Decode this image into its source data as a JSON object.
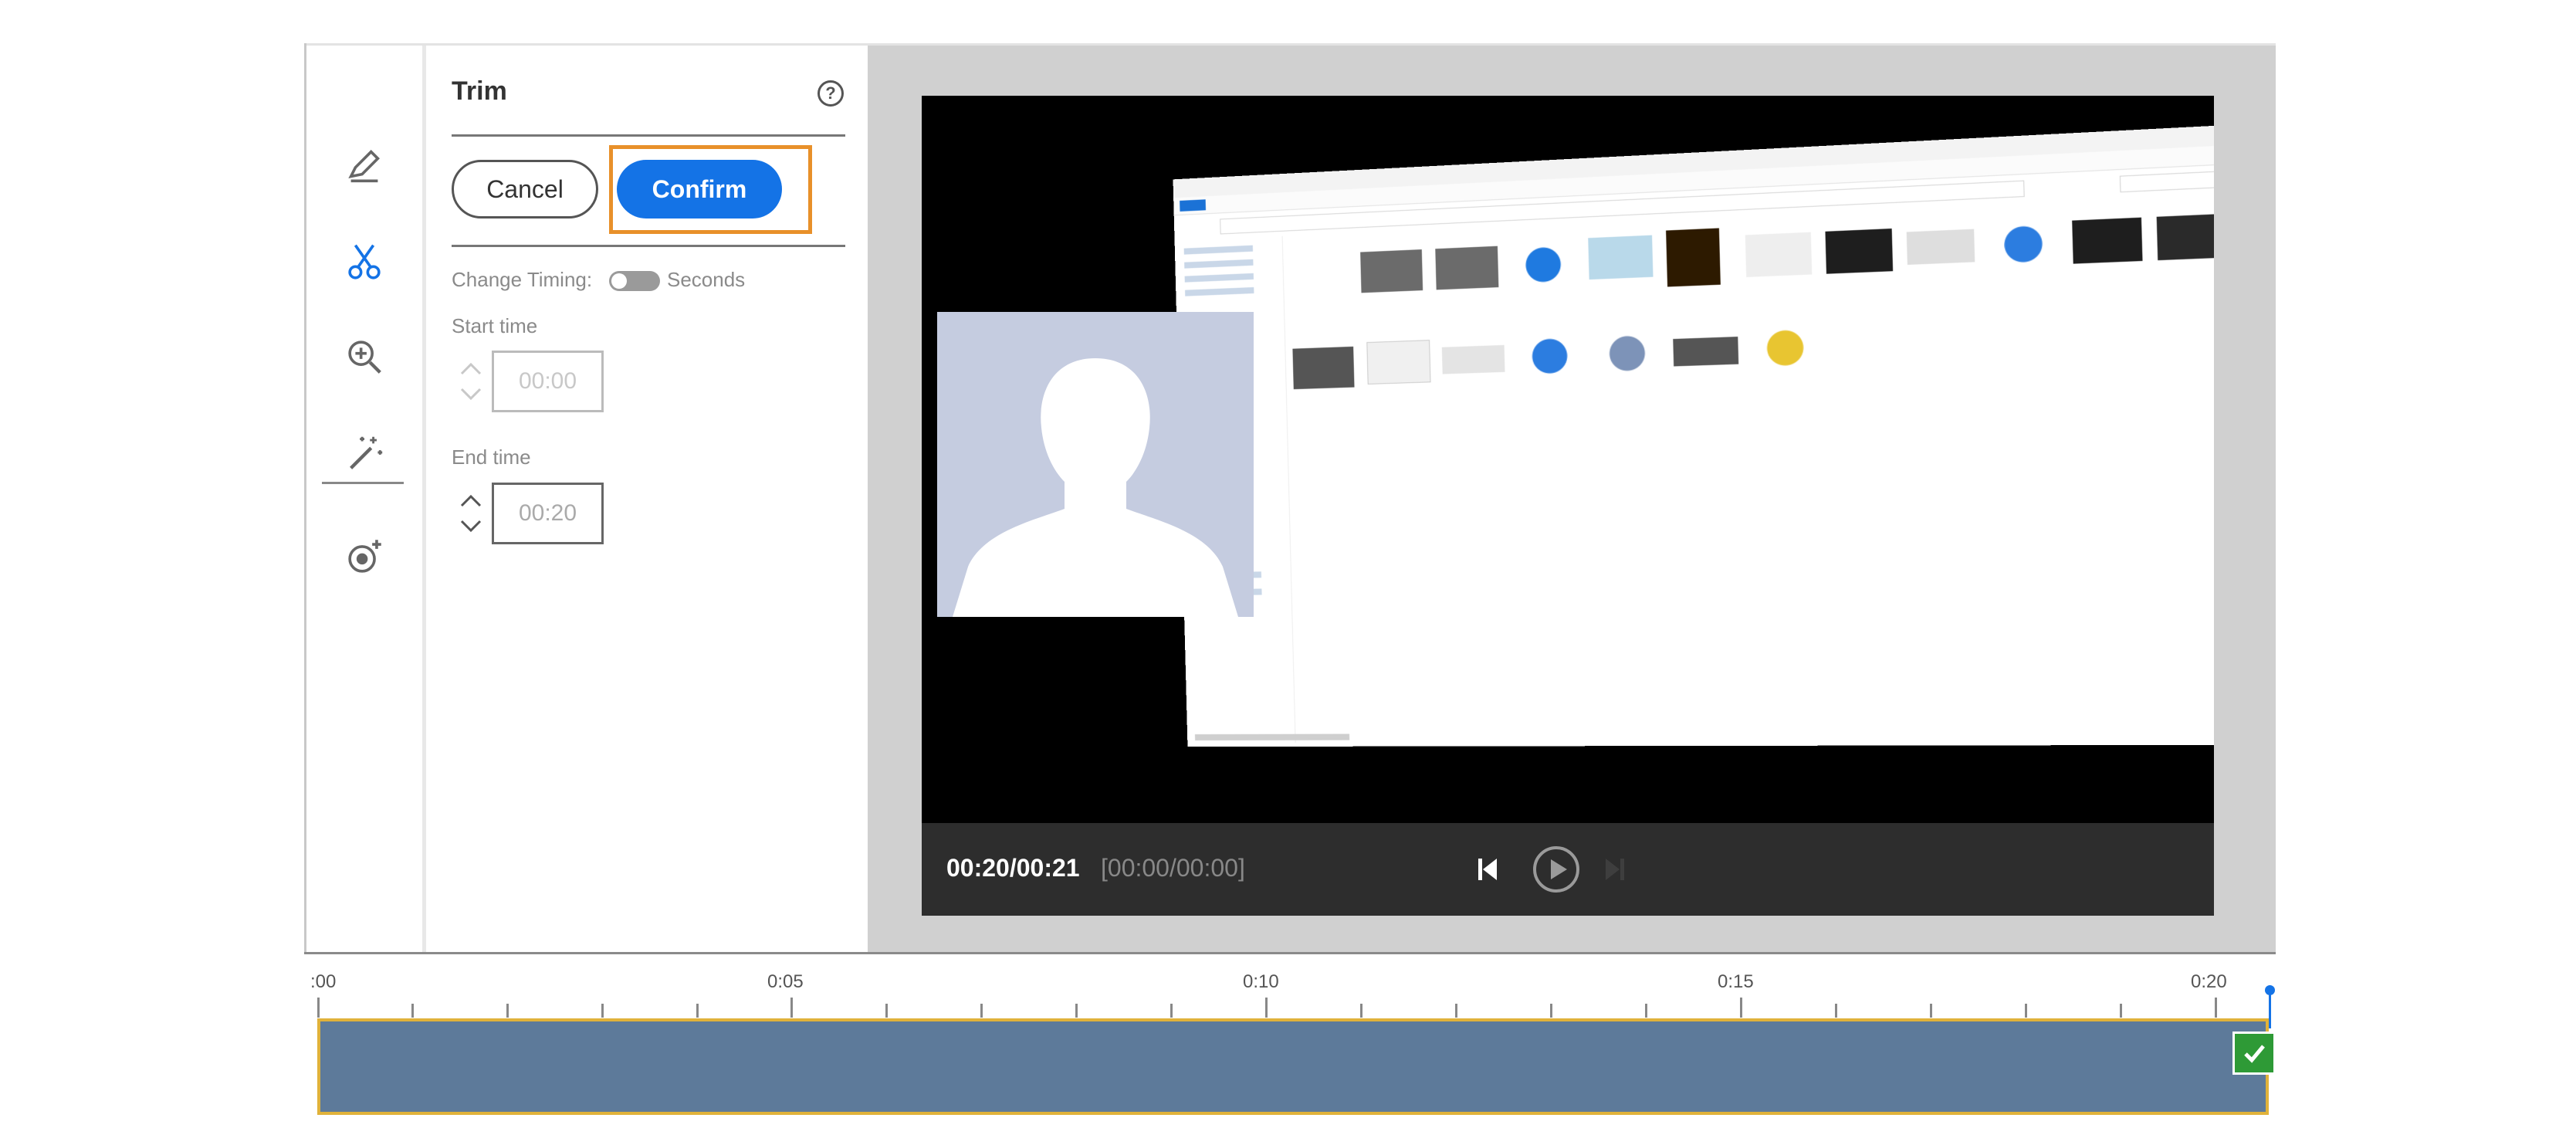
{
  "panel": {
    "title": "Trim",
    "help_icon": "?",
    "cancel_label": "Cancel",
    "confirm_label": "Confirm",
    "change_timing_label": "Change Timing:",
    "seconds_label": "Seconds",
    "seconds_toggle_on": false,
    "start_time_label": "Start time",
    "start_time_value": "00:00",
    "end_time_label": "End time",
    "end_time_value": "00:20"
  },
  "toolbar": {
    "tools": [
      "pen-edit-icon",
      "scissors-icon",
      "zoom-icon",
      "magic-wand-icon",
      "record-add-icon"
    ],
    "active_tool": "scissors-icon"
  },
  "player": {
    "current_time": "00:20/00:21",
    "selection_range": "[00:00/00:00]",
    "controls": [
      "skip-to-start-icon",
      "play-icon",
      "skip-to-end-icon"
    ]
  },
  "timeline": {
    "labels": [
      ":00",
      "0:05",
      "0:10",
      "0:15",
      "0:20"
    ],
    "selection_start": "00:00",
    "selection_end": "00:20",
    "status_icon": "check-icon"
  },
  "colors": {
    "accent": "#1473e6",
    "highlight": "#e8902a",
    "track": "#5d7a9a",
    "track_border": "#e0b23a",
    "done": "#2e9a36"
  }
}
